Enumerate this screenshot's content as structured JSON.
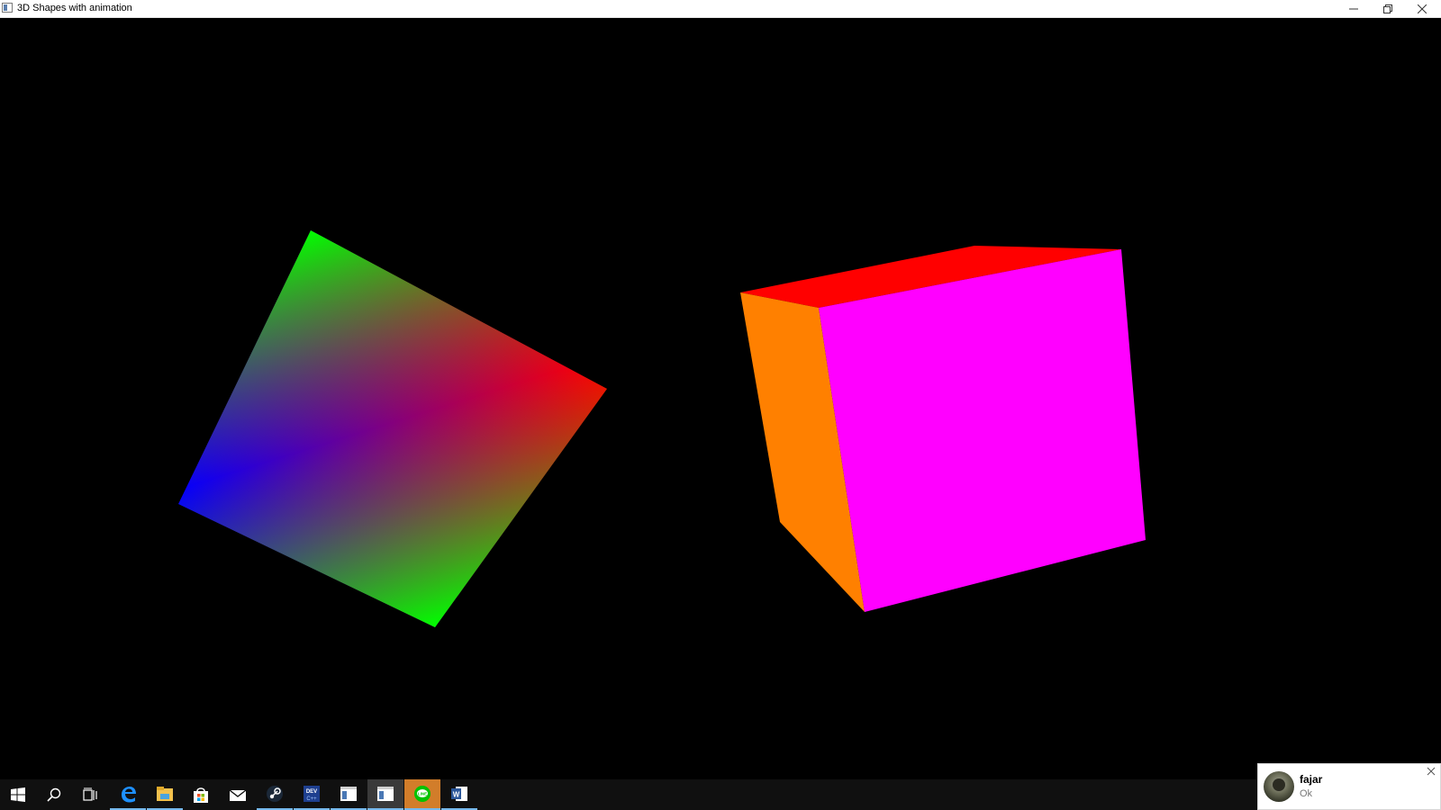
{
  "window": {
    "title": "3D Shapes with animation"
  },
  "scene": {
    "background": "#000000",
    "left_shape": {
      "corner_colors": [
        "#00ff00",
        "#ff0000",
        "#00ff00",
        "#0000ff"
      ]
    },
    "right_cube": {
      "front_face_color": "#ff00ff",
      "top_face_color": "#ff0000",
      "side_face_color": "#ff8000"
    }
  },
  "taskbar": {
    "items": [
      {
        "name": "windows-start-icon"
      },
      {
        "name": "search-icon"
      },
      {
        "name": "task-view-icon"
      },
      {
        "name": "edge-icon"
      },
      {
        "name": "file-explorer-icon"
      },
      {
        "name": "store-icon"
      },
      {
        "name": "mail-icon"
      },
      {
        "name": "steam-icon"
      },
      {
        "name": "dev-cpp-icon"
      },
      {
        "name": "app-window-icon"
      },
      {
        "name": "app-window-active-icon"
      },
      {
        "name": "line-icon"
      },
      {
        "name": "word-icon"
      }
    ]
  },
  "notification": {
    "sender": "fajar",
    "message": "Ok"
  }
}
